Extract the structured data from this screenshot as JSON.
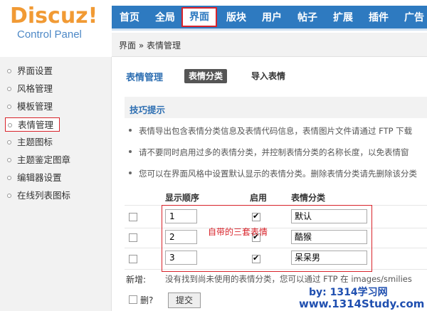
{
  "logo": {
    "main": "Discuz",
    "bang": "!",
    "sub": "Control Panel"
  },
  "topnav": [
    {
      "label": "首页"
    },
    {
      "label": "全局"
    },
    {
      "label": "界面",
      "active": true
    },
    {
      "label": "版块"
    },
    {
      "label": "用户"
    },
    {
      "label": "帖子"
    },
    {
      "label": "扩展"
    },
    {
      "label": "插件"
    },
    {
      "label": "广告"
    }
  ],
  "breadcrumb": "界面 » 表情管理",
  "sidebar": [
    {
      "label": "界面设置"
    },
    {
      "label": "风格管理"
    },
    {
      "label": "模板管理"
    },
    {
      "label": "表情管理",
      "active": true
    },
    {
      "label": "主题图标"
    },
    {
      "label": "主题鉴定图章"
    },
    {
      "label": "编辑器设置"
    },
    {
      "label": "在线列表图标"
    }
  ],
  "main": {
    "title": "表情管理",
    "tab_active": "表情分类",
    "tab_other": "导入表情",
    "tips_title": "技巧提示",
    "tips": [
      "表情导出包含表情分类信息及表情代码信息，表情图片文件请通过 FTP 下载",
      "请不要同时启用过多的表情分类，并控制表情分类的名称长度，以免表情窗",
      "您可以在界面风格中设置默认显示的表情分类。删除表情分类请先删除该分类"
    ],
    "columns": {
      "order": "显示顺序",
      "enabled": "启用",
      "name": "表情分类"
    },
    "rows": [
      {
        "order": "1",
        "enabled": true,
        "name": "默认"
      },
      {
        "order": "2",
        "enabled": true,
        "name": "酷猴"
      },
      {
        "order": "3",
        "enabled": true,
        "name": "呆呆男"
      }
    ],
    "annotation": "自带的三套表情",
    "new_label": "新增:",
    "new_text": "没有找到尚未使用的表情分类，您可以通过 FTP 在 images/smilies",
    "delete_label": "删?",
    "submit_label": "提交"
  },
  "watermark": {
    "line1": "by: 1314学习网",
    "line2": "www.1314Study.com"
  },
  "colors": {
    "nav": "#2e7ac0",
    "accent_red": "#d8232a",
    "title_blue": "#2e6fb2",
    "logo_orange": "#f19a34"
  }
}
